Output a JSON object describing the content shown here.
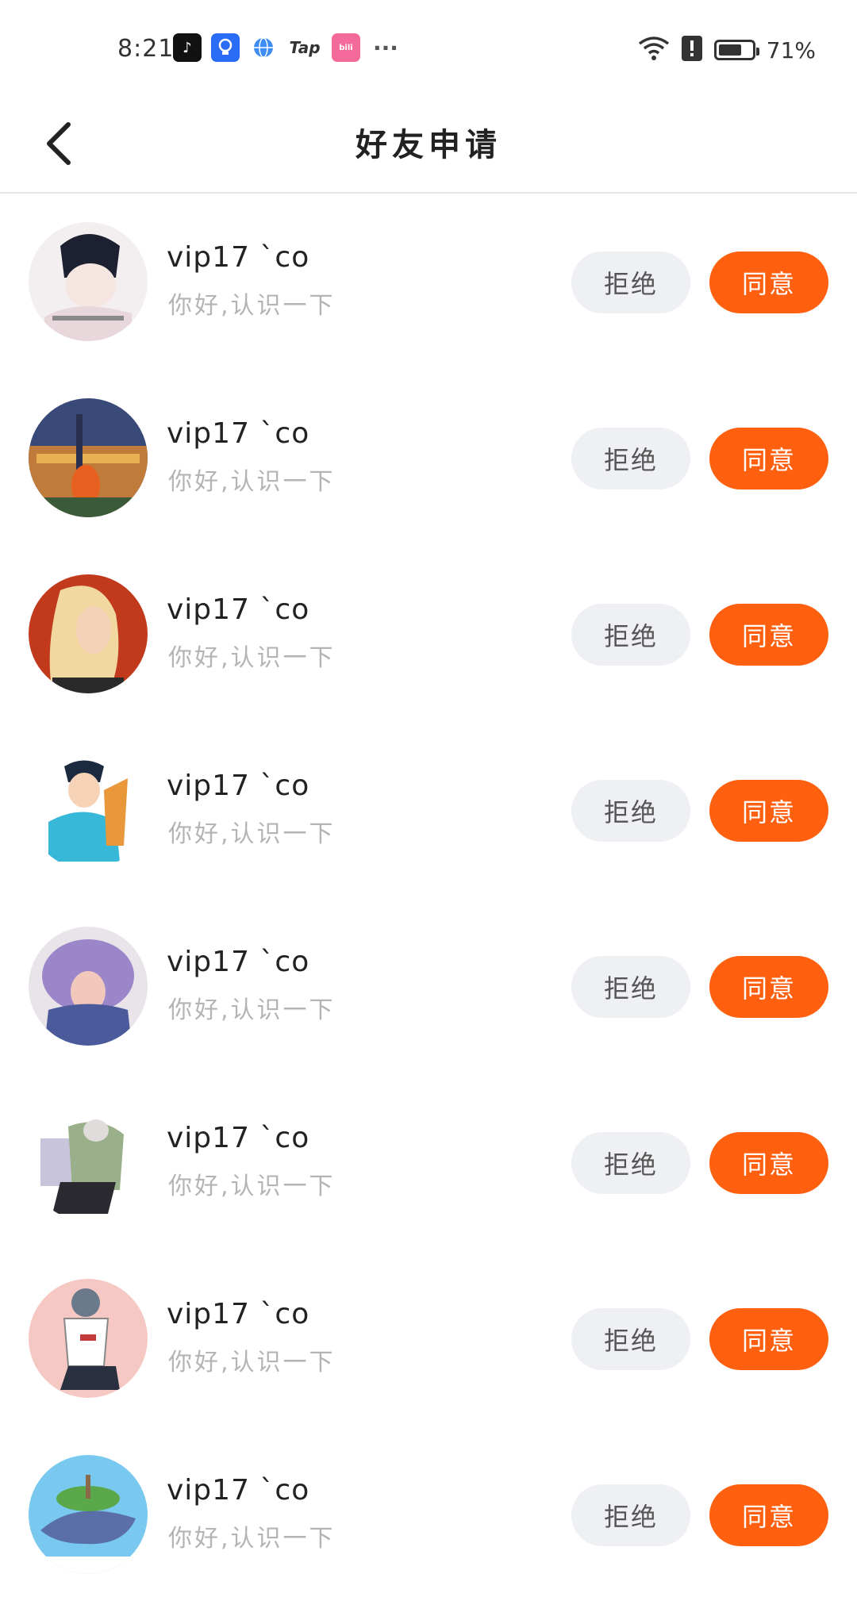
{
  "status_bar": {
    "time": "8:21",
    "notification_icons": [
      "tiktok-icon",
      "lightbulb-icon",
      "globe-icon",
      "tap-icon",
      "bilibili-icon"
    ],
    "more": "···",
    "battery_percent_text": "71%",
    "battery_level": 0.71
  },
  "header": {
    "title": "好友申请"
  },
  "requests": [
    {
      "name": "vip17 `co",
      "message": "你好,认识一下",
      "reject_label": "拒绝",
      "accept_label": "同意"
    },
    {
      "name": "vip17 `co",
      "message": "你好,认识一下",
      "reject_label": "拒绝",
      "accept_label": "同意"
    },
    {
      "name": "vip17 `co",
      "message": "你好,认识一下",
      "reject_label": "拒绝",
      "accept_label": "同意"
    },
    {
      "name": "vip17 `co",
      "message": "你好,认识一下",
      "reject_label": "拒绝",
      "accept_label": "同意"
    },
    {
      "name": "vip17 `co",
      "message": "你好,认识一下",
      "reject_label": "拒绝",
      "accept_label": "同意"
    },
    {
      "name": "vip17 `co",
      "message": "你好,认识一下",
      "reject_label": "拒绝",
      "accept_label": "同意"
    },
    {
      "name": "vip17 `co",
      "message": "你好,认识一下",
      "reject_label": "拒绝",
      "accept_label": "同意"
    },
    {
      "name": "vip17 `co",
      "message": "你好,认识一下",
      "reject_label": "拒绝",
      "accept_label": "同意"
    }
  ],
  "colors": {
    "accent": "#ff6010",
    "reject_bg": "#eef0f4",
    "message_text": "#b4b4b4"
  }
}
